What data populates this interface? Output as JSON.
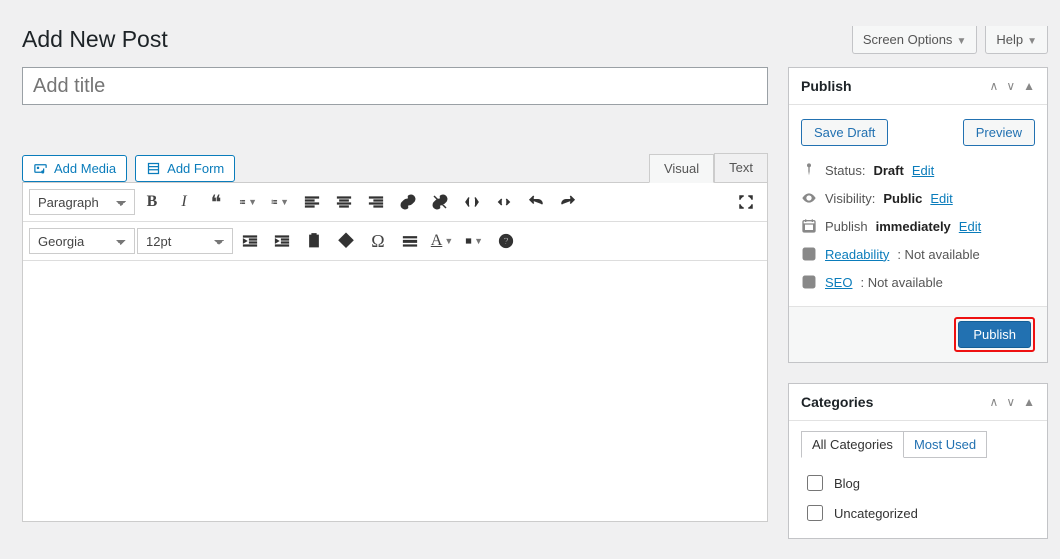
{
  "topbar": {
    "screen_options": "Screen Options",
    "help": "Help"
  },
  "page_title": "Add New Post",
  "title_input": {
    "placeholder": "Add title",
    "value": ""
  },
  "media": {
    "add_media": "Add Media",
    "add_form": "Add Form"
  },
  "editor_tabs": {
    "visual": "Visual",
    "text": "Text"
  },
  "toolbar": {
    "format_select": "Paragraph",
    "font_select": "Georgia",
    "size_select": "12pt"
  },
  "publish": {
    "title": "Publish",
    "save_draft": "Save Draft",
    "preview": "Preview",
    "status_label": "Status:",
    "status_value": "Draft",
    "visibility_label": "Visibility:",
    "visibility_value": "Public",
    "schedule_label": "Publish",
    "schedule_value": "immediately",
    "edit": "Edit",
    "readability_label": "Readability",
    "readability_value": ": Not available",
    "seo_label": "SEO",
    "seo_value": ": Not available",
    "publish_btn": "Publish"
  },
  "categories": {
    "title": "Categories",
    "tab_all": "All Categories",
    "tab_most": "Most Used",
    "items": [
      "Blog",
      "Uncategorized"
    ]
  }
}
